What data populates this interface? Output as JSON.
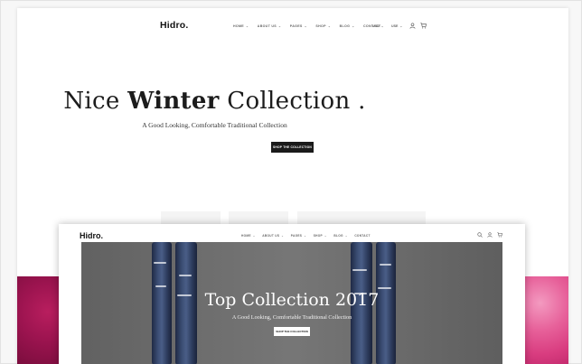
{
  "back_site": {
    "logo": "Hidro.",
    "nav": [
      {
        "label": "HOME",
        "has_dropdown": true
      },
      {
        "label": "ABOUT US",
        "has_dropdown": true
      },
      {
        "label": "PAGES",
        "has_dropdown": true
      },
      {
        "label": "SHOP",
        "has_dropdown": true
      },
      {
        "label": "BLOG",
        "has_dropdown": true
      },
      {
        "label": "CONTACT",
        "has_dropdown": false
      }
    ],
    "currency": "USD",
    "language": "USE",
    "hero": {
      "title_pre": "Nice ",
      "title_bold": "Winter",
      "title_post": " Collection .",
      "subtitle": "A Good Looking, Comfortable Traditional Collection",
      "button": "SHOP THE COLLECTION"
    }
  },
  "front_site": {
    "logo": "Hidro.",
    "nav": [
      {
        "label": "HOME",
        "has_dropdown": true
      },
      {
        "label": "ABOUT US",
        "has_dropdown": true
      },
      {
        "label": "PAGES",
        "has_dropdown": true
      },
      {
        "label": "SHOP",
        "has_dropdown": true
      },
      {
        "label": "BLOG",
        "has_dropdown": true
      },
      {
        "label": "CONTACT",
        "has_dropdown": false
      }
    ],
    "banner": {
      "title": "Top Collection 2017",
      "subtitle": "A Good Looking, Comfortable Traditional Collection",
      "button": "SHOP THE COLLECTION"
    }
  },
  "icons": {
    "user": "user-icon",
    "cart": "cart-icon",
    "search": "search-icon",
    "chevron": "chevron-down-icon"
  },
  "colors": {
    "button_dark": "#1a1a1a",
    "magenta": "#9d1450",
    "pink": "#e7619a",
    "denim": "#3b4d73"
  }
}
